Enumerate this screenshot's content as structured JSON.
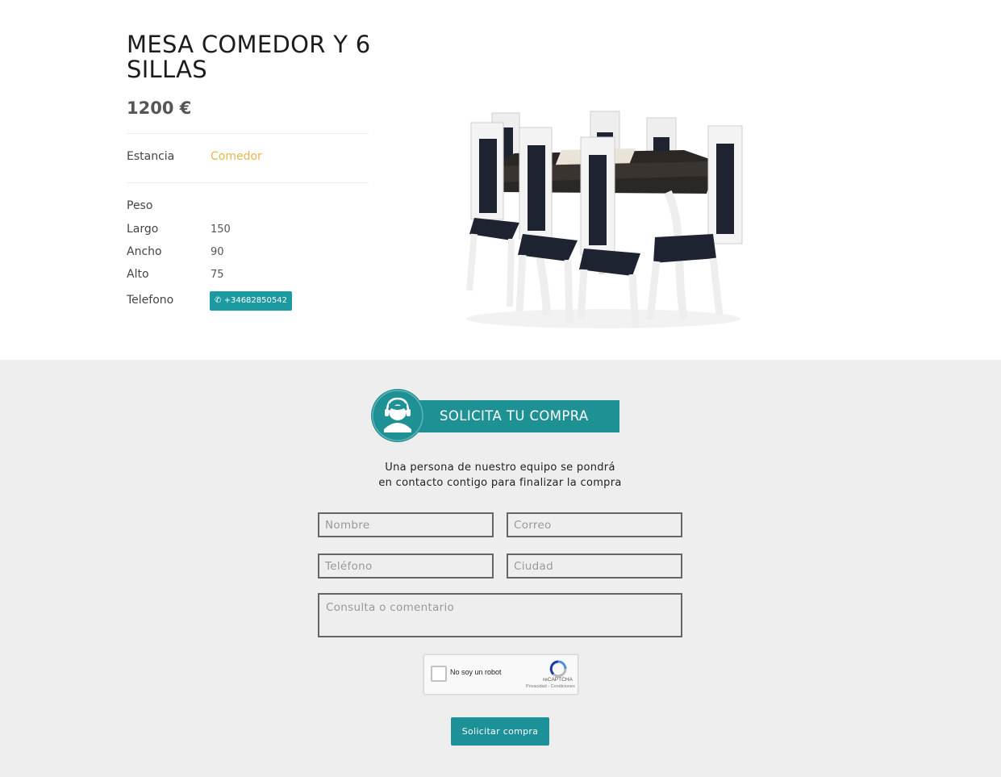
{
  "product": {
    "title": "MESA COMEDOR Y 6 SILLAS",
    "price": "1200 €",
    "room_label": "Estancia",
    "room_value": "Comedor",
    "specs": [
      {
        "label": "Peso",
        "value": ""
      },
      {
        "label": "Largo",
        "value": "150"
      },
      {
        "label": "Ancho",
        "value": "90"
      },
      {
        "label": "Alto",
        "value": "75"
      }
    ],
    "phone_label": "Telefono",
    "phone_value": "+34682850542",
    "image_icon": "dining-table-chairs-photo"
  },
  "form": {
    "banner_title": "SOLICITA TU COMPRA",
    "subtitle_line1": "Una persona de nuestro equipo se pondrá",
    "subtitle_line2": "en contacto contigo para finalizar la compra",
    "name_placeholder": "Nombre",
    "email_placeholder": "Correo",
    "phone_placeholder": "Teléfono",
    "city_placeholder": "Ciudad",
    "comment_placeholder": "Consulta o comentario",
    "captcha_label": "No soy un robot",
    "captcha_brand": "reCAPTCHA",
    "captcha_terms": "Privacidad - Condiciones",
    "submit_label": "Solicitar compra"
  },
  "colors": {
    "accent": "#1c9aa1",
    "link": "#e9b44c",
    "form_bg": "#eeeeee"
  }
}
